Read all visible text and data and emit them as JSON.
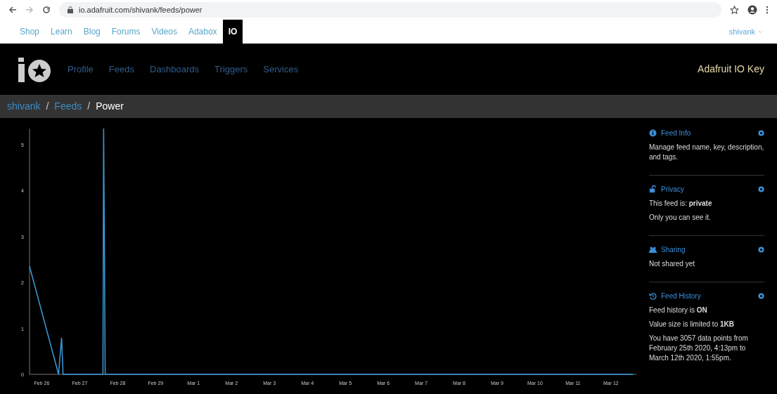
{
  "browser": {
    "url": "io.adafruit.com/shivank/feeds/power"
  },
  "site_nav": {
    "items": [
      {
        "label": "Shop",
        "selected": false
      },
      {
        "label": "Learn",
        "selected": false
      },
      {
        "label": "Blog",
        "selected": false
      },
      {
        "label": "Forums",
        "selected": false
      },
      {
        "label": "Videos",
        "selected": false
      },
      {
        "label": "Adabox",
        "selected": false
      },
      {
        "label": "IO",
        "selected": true
      }
    ],
    "user": "shivank"
  },
  "header": {
    "nav": [
      "Profile",
      "Feeds",
      "Dashboards",
      "Triggers",
      "Services"
    ],
    "key_link": "Adafruit IO Key"
  },
  "breadcrumb": {
    "separator": "/",
    "items": [
      {
        "label": "shivank",
        "link": true
      },
      {
        "label": "Feeds",
        "link": true
      },
      {
        "label": "Power",
        "link": false
      }
    ]
  },
  "chart_data": {
    "type": "line",
    "series": [
      {
        "color": "#3b9bd9",
        "values": [
          2.35,
          0,
          0.8,
          0,
          0,
          5.35,
          0,
          0
        ]
      }
    ],
    "x": [
      "2020-02-25T16:13:00Z",
      "2020-02-26T10:34:00Z",
      "2020-02-26T12:29:00Z",
      "2020-02-26T13:26:00Z",
      "2020-02-27T14:38:00Z",
      "2020-02-27T15:07:00Z",
      "2020-02-27T16:05:00Z",
      "2020-03-12T13:55:00Z"
    ],
    "xlim": [
      "2020-02-25T16:13:00Z",
      "2020-03-12T16:05:00Z"
    ],
    "ylim": [
      0,
      5.35
    ],
    "xticks": [
      {
        "value": "2020-02-26T00:00:00Z",
        "label": "Feb 26"
      },
      {
        "value": "2020-02-27T00:00:00Z",
        "label": "Feb 27"
      },
      {
        "value": "2020-02-28T00:00:00Z",
        "label": "Feb 28"
      },
      {
        "value": "2020-02-29T00:00:00Z",
        "label": "Feb 29"
      },
      {
        "value": "2020-03-01T00:00:00Z",
        "label": "Mar 1"
      },
      {
        "value": "2020-03-02T00:00:00Z",
        "label": "Mar 2"
      },
      {
        "value": "2020-03-03T00:00:00Z",
        "label": "Mar 3"
      },
      {
        "value": "2020-03-04T00:00:00Z",
        "label": "Mar 4"
      },
      {
        "value": "2020-03-05T00:00:00Z",
        "label": "Mar 5"
      },
      {
        "value": "2020-03-06T00:00:00Z",
        "label": "Mar 6"
      },
      {
        "value": "2020-03-07T00:00:00Z",
        "label": "Mar 7"
      },
      {
        "value": "2020-03-08T00:00:00Z",
        "label": "Mar 8"
      },
      {
        "value": "2020-03-09T00:00:00Z",
        "label": "Mar 9"
      },
      {
        "value": "2020-03-10T00:00:00Z",
        "label": "Mar 10"
      },
      {
        "value": "2020-03-11T00:00:00Z",
        "label": "Mar 11"
      },
      {
        "value": "2020-03-12T00:00:00Z",
        "label": "Mar 12"
      }
    ],
    "yticks": [
      0,
      1,
      2,
      3,
      4,
      5
    ]
  },
  "sidebar": [
    {
      "kind": "info",
      "title": "Feed Info",
      "lines": [
        "Manage feed name, key, description, and tags."
      ]
    },
    {
      "kind": "privacy",
      "title": "Privacy",
      "lines": [
        "This feed is: **private**",
        "Only you can see it."
      ]
    },
    {
      "kind": "sharing",
      "title": "Sharing",
      "lines": [
        "Not shared yet"
      ]
    },
    {
      "kind": "history",
      "title": "Feed History",
      "lines": [
        "Feed history is **ON**",
        "Value size is limited to **1KB**",
        "You have 3057 data points from February 25th 2020, 4:13pm to March 12th 2020, 1:55pm."
      ]
    }
  ]
}
